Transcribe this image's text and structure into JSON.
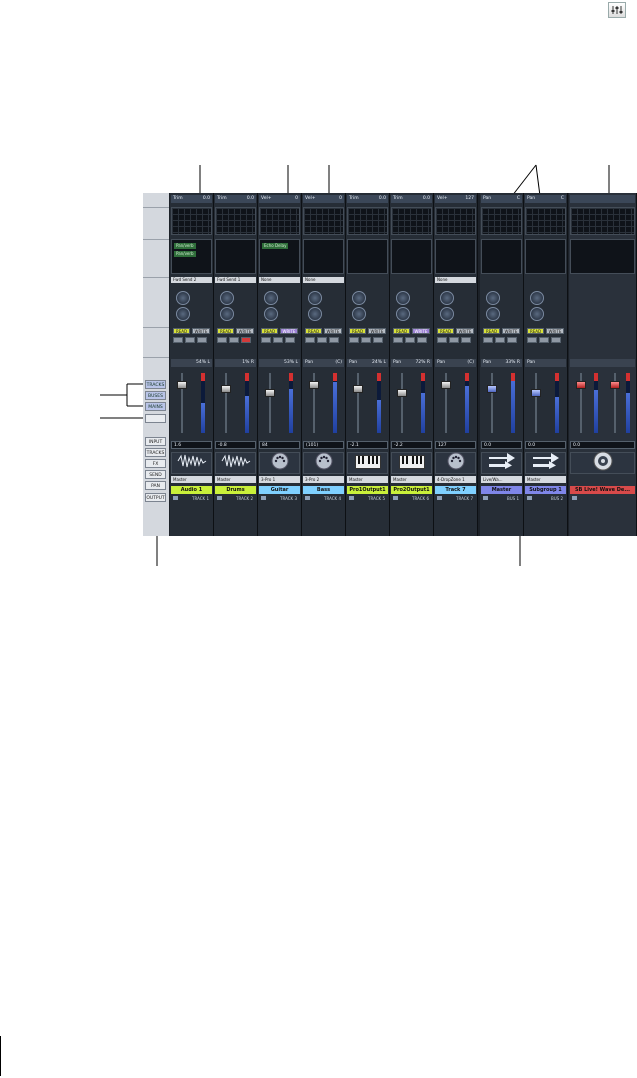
{
  "corner_icon": "mixer-sliders-icon",
  "left_strip": {
    "buttons": [
      "TRACKS",
      "BUSES",
      "MAINS",
      "",
      "INPUT",
      "TRACKS",
      "FX",
      "SEND",
      "PAN",
      "OUTPUT"
    ]
  },
  "strips": [
    {
      "type": "track",
      "header_label": "Trim",
      "header_value": "0.0",
      "fx": [
        "Pan/verb",
        "Pan/verb"
      ],
      "send_label": "Fwd Send 2",
      "rw": {
        "read": "READ",
        "write": "WRITE",
        "write_active": false
      },
      "pan_label": "",
      "pan_value": "54% L",
      "fader_value": "1.6",
      "icon": "waveform-icon",
      "output": "Master",
      "name": "Audio 1",
      "name_color": "#c9f03a",
      "number": "TRACK 1"
    },
    {
      "type": "track",
      "header_label": "Trim",
      "header_value": "0.0",
      "fx": [],
      "send_label": "Fwd Send 1",
      "rw": {
        "read": "READ",
        "write": "WRITE",
        "write_active": false
      },
      "pan_label": "",
      "pan_value": "1% R",
      "fader_value": "-0.8",
      "icon": "waveform-icon",
      "output": "Master",
      "name": "Drums",
      "name_color": "#c9f03a",
      "number": "TRACK 2"
    },
    {
      "type": "track",
      "header_label": "Vel+",
      "header_value": "0",
      "fx": [
        "Echo Delay"
      ],
      "send_label": "None",
      "rw": {
        "read": "READ",
        "write": "WRITE",
        "write_active": true
      },
      "pan_label": "",
      "pan_value": "53% L",
      "fader_value": "84",
      "icon": "midi-port-icon",
      "output": "3-Pro 1",
      "name": "Guitar",
      "name_color": "#7fd0ff",
      "number": "TRACK 3"
    },
    {
      "type": "track",
      "header_label": "Vel+",
      "header_value": "0",
      "fx": [],
      "send_label": "None",
      "rw": {
        "read": "READ",
        "write": "WRITE",
        "write_active": false
      },
      "pan_label": "Pan",
      "pan_value": "(C)",
      "fader_value": "(101)",
      "icon": "midi-port-icon",
      "output": "3-Pro 2",
      "name": "Bass",
      "name_color": "#7fd0ff",
      "number": "TRACK 4"
    },
    {
      "type": "track",
      "header_label": "Trim",
      "header_value": "0.0",
      "fx": [],
      "send_label": "",
      "rw": {
        "read": "READ",
        "write": "WRITE",
        "write_active": false
      },
      "pan_label": "Pan",
      "pan_value": "24% L",
      "fader_value": "-2.1",
      "icon": "keyboard-icon",
      "output": "Master",
      "name": "Pro1Output1",
      "name_color": "#c9f03a",
      "number": "TRACK 5"
    },
    {
      "type": "track",
      "header_label": "Trim",
      "header_value": "0.0",
      "fx": [],
      "send_label": "",
      "rw": {
        "read": "READ",
        "write": "WRITE",
        "write_active": true
      },
      "pan_label": "Pan",
      "pan_value": "72% R",
      "fader_value": "-2.2",
      "icon": "keyboard-icon",
      "output": "Master",
      "name": "Pro2Output1",
      "name_color": "#c9f03a",
      "number": "TRACK 6"
    },
    {
      "type": "track",
      "header_label": "Vel+",
      "header_value": "127",
      "fx": [],
      "send_label": "None",
      "rw": {
        "read": "READ",
        "write": "WRITE",
        "write_active": false
      },
      "pan_label": "Pan",
      "pan_value": "(C)",
      "fader_value": "127",
      "icon": "midi-port-icon",
      "output": "4-DropZone 1",
      "name": "Track 7",
      "name_color": "#7fd0ff",
      "number": "TRACK 7"
    },
    {
      "type": "bus",
      "header_label": "Pan",
      "header_value": "C",
      "fx": [],
      "send_label": "",
      "rw": {
        "read": "READ",
        "write": "WRITE",
        "write_active": false
      },
      "pan_label": "Pan",
      "pan_value": "33% R",
      "fader_value": "0.0",
      "icon": "bus-arrows-icon",
      "output": "Live/Wa...",
      "name": "Master",
      "name_color": "#7f86e8",
      "number": "BUS 1"
    },
    {
      "type": "bus",
      "header_label": "Pan",
      "header_value": "C",
      "fx": [],
      "send_label": "",
      "rw": {
        "read": "READ",
        "write": "WRITE",
        "write_active": false
      },
      "pan_label": "Pan",
      "pan_value": "",
      "fader_value": "0.0",
      "icon": "bus-arrows-icon",
      "output": "Master",
      "name": "Subgroup 1",
      "name_color": "#7f86e8",
      "number": "BUS 2"
    },
    {
      "type": "main",
      "header_label": "",
      "header_value": "",
      "fx": [],
      "send_label": "",
      "rw": null,
      "pan_label": "",
      "pan_value": "",
      "fader_value": "0.0",
      "fader_value_2": "0.0",
      "icon": "speaker-icon",
      "output": "",
      "name": "SB Live! Wave De...",
      "name_color": "#d84a4a",
      "number": ""
    }
  ]
}
